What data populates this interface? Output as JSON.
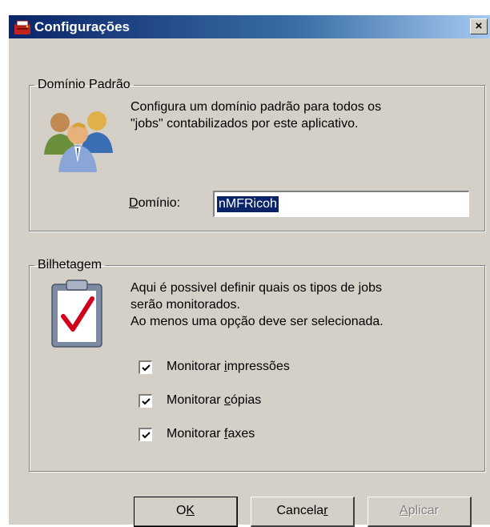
{
  "window": {
    "title": "Configurações",
    "close_label": "×",
    "title_icon": "app-icon"
  },
  "dominio_group": {
    "legend": "Domínio Padrão",
    "icon": "users-icon",
    "description_line1": "Configura um domínio padrão para todos os",
    "description_line2": "\"jobs\" contabilizados por este aplicativo.",
    "field_label_prefix": "D",
    "field_label_rest": "omínio:",
    "field_value": "nMFRicoh"
  },
  "bilhetagem_group": {
    "legend": "Bilhetagem",
    "icon": "clipboard-check-icon",
    "description_line1": "Aqui é possivel definir quais os tipos de jobs",
    "description_line2": "serão monitorados.",
    "description_line3": "Ao menos uma opção deve ser selecionada.",
    "options": [
      {
        "pre": "Monitorar ",
        "key": "i",
        "post": "mpressões",
        "checked": true
      },
      {
        "pre": "Monitorar ",
        "key": "c",
        "post": "ópias",
        "checked": true
      },
      {
        "pre": "Monitorar ",
        "key": "f",
        "post": "axes",
        "checked": true
      }
    ]
  },
  "buttons": {
    "ok_pre": "O",
    "ok_key": "K",
    "ok_post": "",
    "cancel_pre": "Cancela",
    "cancel_key": "r",
    "cancel_post": "",
    "apply_pre": "",
    "apply_key": "A",
    "apply_post": "plicar",
    "apply_enabled": false
  },
  "colors": {
    "titlebar_start": "#0a246a",
    "titlebar_end": "#a6caf0",
    "face": "#d4d0c8",
    "selection": "#0a246a"
  }
}
